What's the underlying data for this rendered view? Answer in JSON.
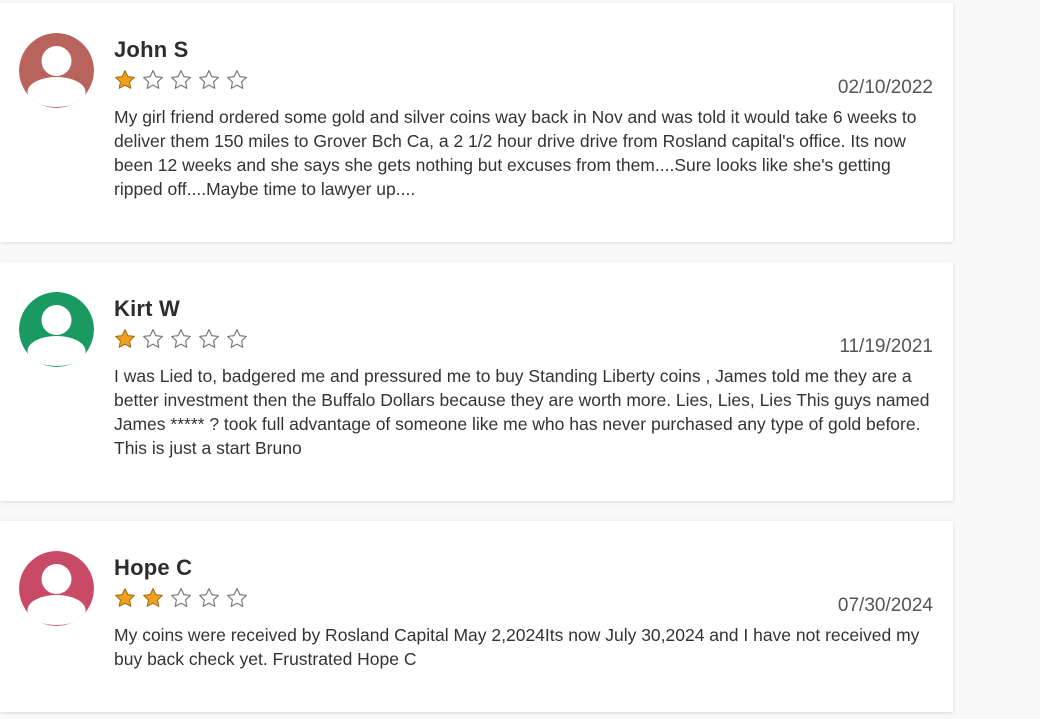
{
  "colors": {
    "star_filled": "#f0a01e",
    "star_empty_stroke": "#7a7a7a",
    "card_bg": "#ffffff",
    "page_bg": "#f9f9f9"
  },
  "reviews": [
    {
      "name": "John S",
      "rating": 1,
      "max_rating": 5,
      "date": "02/10/2022",
      "avatar_color": "#b8635b",
      "avatar_icon": "user-avatar-icon",
      "text": "My girl friend ordered some gold and silver coins way back in Nov and was told it would take 6 weeks to deliver them 150 miles to Grover Bch Ca, a 2 1/2 hour drive drive from Rosland capital's office. Its now been 12 weeks and she says she gets nothing but excuses from them....Sure looks like she's getting ripped off....Maybe time to lawyer up...."
    },
    {
      "name": "Kirt W",
      "rating": 1,
      "max_rating": 5,
      "date": "11/19/2021",
      "avatar_color": "#1a9a62",
      "avatar_icon": "user-avatar-icon",
      "text": "I was Lied to, badgered me and pressured me to buy Standing Liberty coins , James told me they are a better investment then the Buffalo Dollars because they are worth more. Lies, Lies, Lies This guys named James ***** ? took full advantage of someone like me who has never purchased any type of gold before. This is just a start Bruno"
    },
    {
      "name": "Hope C",
      "rating": 2,
      "max_rating": 5,
      "date": "07/30/2024",
      "avatar_color": "#c94a66",
      "avatar_icon": "user-avatar-icon",
      "text": "My coins were received by Rosland Capital May 2,2024Its now July 30,2024 and I have not received my buy back check yet. Frustrated Hope C"
    }
  ]
}
